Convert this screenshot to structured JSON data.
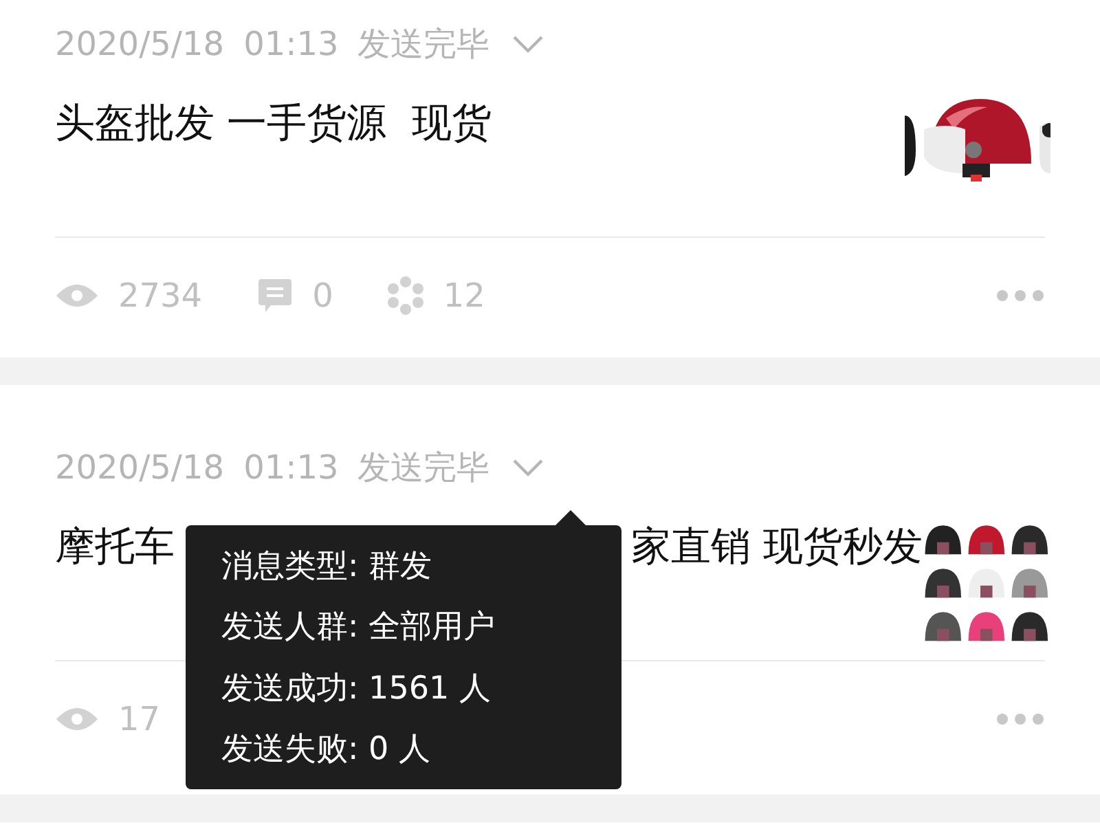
{
  "posts": [
    {
      "date": "2020/5/18",
      "time": "01:13",
      "status": "发送完毕",
      "title_parts": [
        "头盔批发 一手货源  现货"
      ],
      "thumbnail": {
        "kind": "picture"
      },
      "stats": [
        {
          "kind": "views",
          "value": "2734"
        },
        {
          "kind": "comments",
          "value": "0"
        },
        {
          "kind": "shares",
          "value": "12"
        }
      ]
    },
    {
      "date": "2020/5/18",
      "time": "01:13",
      "status": "发送完毕",
      "title_parts": [
        "摩托车",
        "家直销 现货秒发"
      ],
      "thumbnail": {
        "kind": "picture"
      },
      "stats": [
        {
          "kind": "views",
          "value": "17"
        }
      ]
    }
  ],
  "tooltip": {
    "lines": [
      "消息类型: 群发",
      "发送人群: 全部用户",
      "发送成功: 1561 人",
      "发送失败: 0 人"
    ]
  }
}
